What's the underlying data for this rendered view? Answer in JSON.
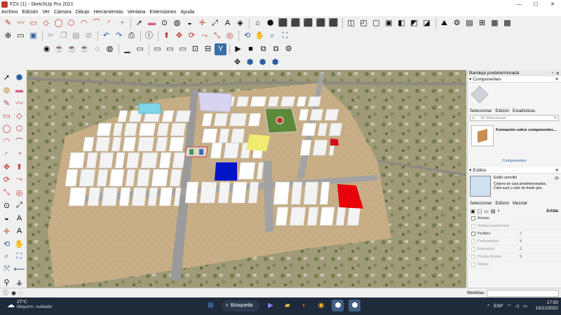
{
  "window": {
    "title": "FZX (1) - SketchUp Pro 2021",
    "minimize": "—",
    "maximize": "☐",
    "close": "✕"
  },
  "menu": [
    "Archivo",
    "Edición",
    "Ver",
    "Cámara",
    "Dibujo",
    "Herramientas",
    "Ventana",
    "Extensiones",
    "Ayuda"
  ],
  "tray": {
    "title": "Bandeja predeterminada",
    "components": {
      "header": "Componentes",
      "tabs": [
        "Seleccionar",
        "Edición",
        "Estadísticas"
      ],
      "search_placeholder": "3D Warehouse",
      "item_label": "Formación sobre componentes...",
      "footer": "Componentes"
    },
    "styles": {
      "header": "Estilos",
      "style_name": "Estilo sencillo",
      "style_desc": "Colores de cara predeterminados. Cielo azul y color de fondo gris.",
      "tabs": [
        "Seleccionar",
        "Edición",
        "Mezclar"
      ],
      "section": "Arista",
      "rows": [
        {
          "label": "Aristas",
          "value": ""
        },
        {
          "label": "Aristas posteriores",
          "value": ""
        },
        {
          "label": "Perfiles",
          "value": "2"
        },
        {
          "label": "Profundidad",
          "value": "4"
        },
        {
          "label": "Extensión",
          "value": "3"
        },
        {
          "label": "Puntos finales",
          "value": "9"
        },
        {
          "label": "Alterar",
          "value": ""
        }
      ]
    }
  },
  "status": {
    "measure_label": "Medidas"
  },
  "taskbar": {
    "temp": "27°C",
    "condition": "Mayorm. nublado",
    "search": "Búsqueda",
    "lang": "ESP",
    "time": "17:50",
    "date": "13/12/2022"
  },
  "colors": {
    "red_block": "#e8000a",
    "blue_block": "#0014c8",
    "yellow_block": "#f0ec70",
    "lilac_block": "#d6d4ee",
    "cyan_block": "#7ed6e8",
    "ground": "#c5ad86",
    "roads": "#9a9a9a"
  }
}
